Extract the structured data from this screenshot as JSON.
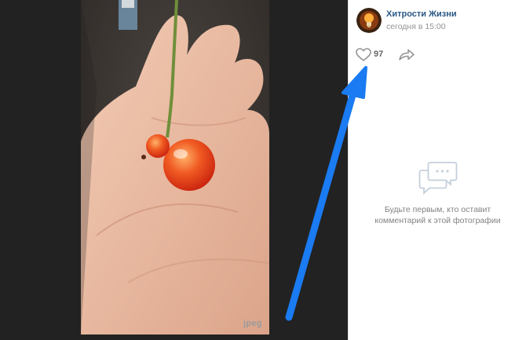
{
  "viewer": {
    "file_tag": "jpeg"
  },
  "post": {
    "author": "Хитрости Жизни",
    "timestamp": "сегодня в 15:00",
    "avatar_icon": "lightbulb-avatar-icon"
  },
  "actions": {
    "like_icon": "heart-icon",
    "like_count": "97",
    "share_icon": "share-arrow-icon"
  },
  "comments": {
    "empty_icon": "comments-bubbles-icon",
    "empty_line1": "Будьте первым, кто оставит",
    "empty_line2": "комментарий к этой фотографии"
  },
  "annotation": {
    "color": "#1a7bf2",
    "points_to": "like-button"
  },
  "colors": {
    "link": "#2a5885",
    "muted": "#939393",
    "viewer_bg": "#222222",
    "panel_bg": "#ffffff"
  }
}
